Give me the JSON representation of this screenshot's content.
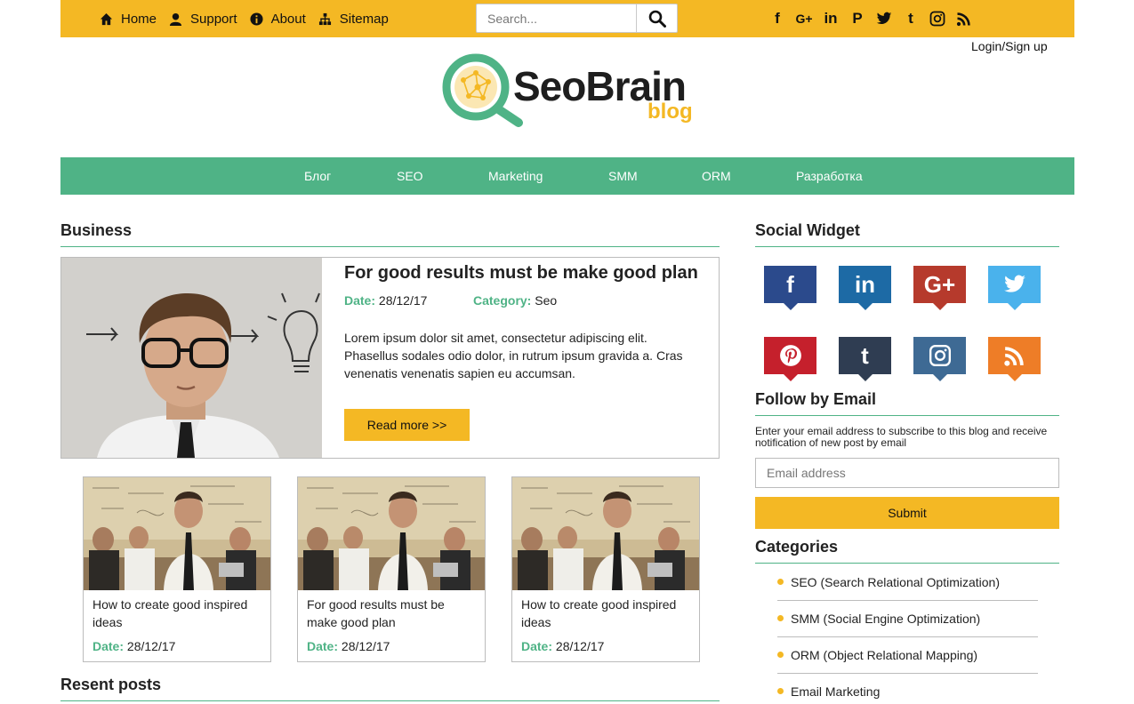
{
  "topbar": {
    "nav": [
      {
        "label": "Home",
        "icon": "home-icon"
      },
      {
        "label": "Support",
        "icon": "support-icon"
      },
      {
        "label": "About",
        "icon": "info-icon"
      },
      {
        "label": "Sitemap",
        "icon": "sitemap-icon"
      }
    ],
    "search_placeholder": "Search...",
    "social_icons": [
      "facebook-icon",
      "google-plus-icon",
      "linkedin-icon",
      "pinterest-icon",
      "twitter-icon",
      "tumblr-icon",
      "instagram-icon",
      "rss-icon"
    ],
    "accent_color": "#f4b824"
  },
  "login_label": "Login/Sign up",
  "logo": {
    "brand": "SeoBrain",
    "sub": "blog"
  },
  "mainnav": {
    "items": [
      "Блог",
      "SEO",
      "Marketing",
      "SMM",
      "ORM",
      "Разработка"
    ],
    "color": "#4fb386"
  },
  "business": {
    "heading": "Business",
    "featured": {
      "title": "For good results must be make good plan",
      "date_label": "Date:",
      "date": "28/12/17",
      "category_label": "Category:",
      "category": "Seo",
      "body": "Lorem ipsum dolor sit amet, consectetur adipiscing elit. Phasellus sodales odio dolor, in rutrum ipsum gravida a. Cras venenatis venenatis sapien eu accumsan.",
      "read_more": "Read more >>"
    },
    "cards": [
      {
        "title": "How to create good inspired ideas",
        "date_label": "Date:",
        "date": "28/12/17"
      },
      {
        "title": "For good results must be make good plan",
        "date_label": "Date:",
        "date": "28/12/17"
      },
      {
        "title": "How to create good inspired ideas",
        "date_label": "Date:",
        "date": "28/12/17"
      }
    ]
  },
  "recent": {
    "heading": "Resent posts"
  },
  "sidebar": {
    "social_heading": "Social Widget",
    "social_widgets": [
      {
        "icon": "facebook-icon",
        "color": "#2b4a8c"
      },
      {
        "icon": "linkedin-icon",
        "color": "#1d6aa5"
      },
      {
        "icon": "google-plus-icon",
        "color": "#b63a2c"
      },
      {
        "icon": "twitter-icon",
        "color": "#4ab2ec"
      },
      {
        "icon": "pinterest-icon",
        "color": "#c5202c"
      },
      {
        "icon": "tumblr-icon",
        "color": "#2f3d52"
      },
      {
        "icon": "instagram-icon",
        "color": "#3e6a94"
      },
      {
        "icon": "rss-icon",
        "color": "#ee7d27"
      }
    ],
    "follow_heading": "Follow by Email",
    "follow_text": "Enter your email address to subscribe to this blog and receive notification of new post by email",
    "email_placeholder": "Email address",
    "submit_label": "Submit",
    "categories_heading": "Categories",
    "categories": [
      "SEO (Search Relational Optimization)",
      "SMM (Social Engine Optimization)",
      "ORM (Object Relational Mapping)",
      "Email Marketing"
    ]
  }
}
